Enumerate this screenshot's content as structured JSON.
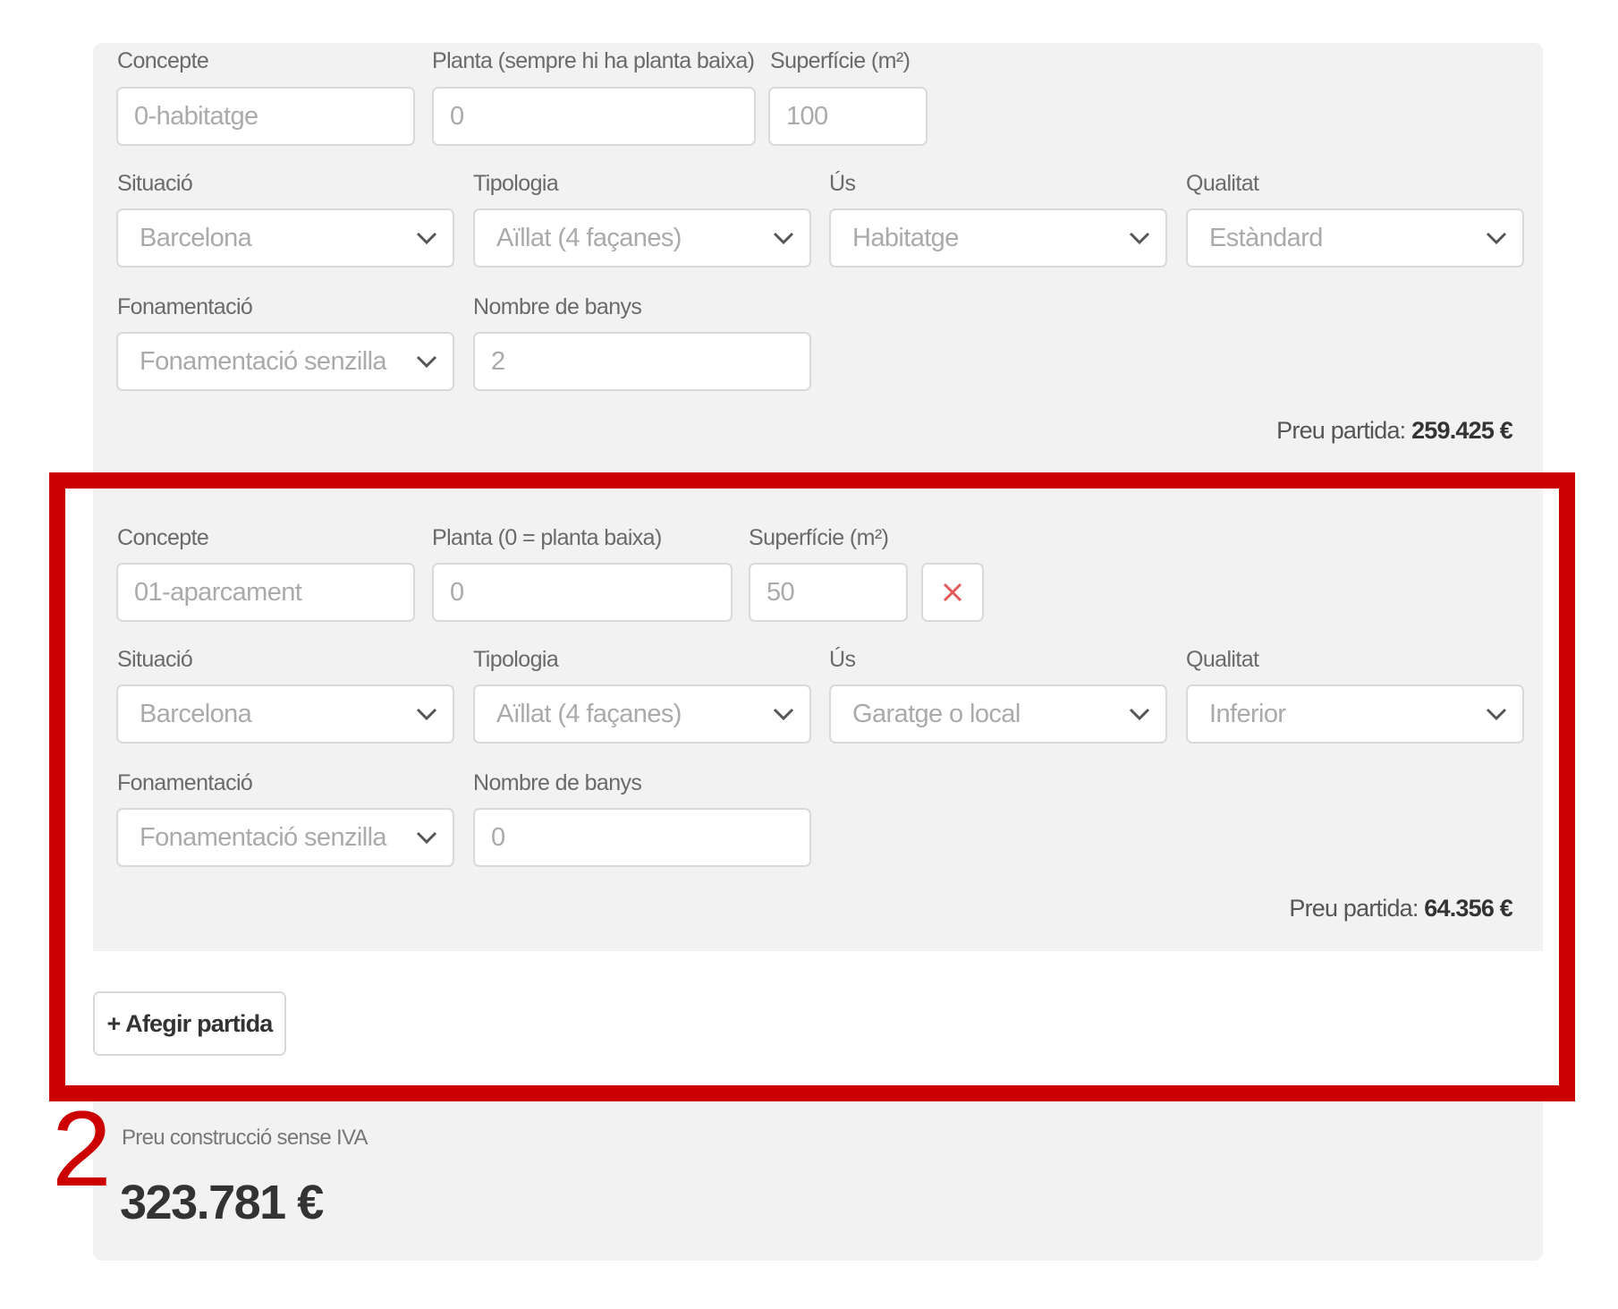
{
  "labels": {
    "concepte": "Concepte",
    "planta_first": "Planta (sempre hi ha planta baixa)",
    "planta_second": "Planta (0 = planta baixa)",
    "superficie": "Superfície (m²)",
    "situacio": "Situació",
    "tipologia": "Tipologia",
    "us": "Ús",
    "qualitat": "Qualitat",
    "fonamentacio": "Fonamentació",
    "banys": "Nombre de banys",
    "preu_partida": "Preu partida:"
  },
  "items": [
    {
      "concepte": "0-habitatge",
      "planta": "0",
      "superficie": "100",
      "situacio": "Barcelona",
      "tipologia": "Aïllat (4 façanes)",
      "us": "Habitatge",
      "qualitat": "Estàndard",
      "fonamentacio": "Fonamentació senzilla",
      "banys": "2",
      "preu": "259.425 €"
    },
    {
      "concepte": "01-aparcament",
      "planta": "0",
      "superficie": "50",
      "situacio": "Barcelona",
      "tipologia": "Aïllat (4 façanes)",
      "us": "Garatge o local",
      "qualitat": "Inferior",
      "fonamentacio": "Fonamentació senzilla",
      "banys": "0",
      "preu": "64.356 €"
    }
  ],
  "add_button": "+ Afegir partida",
  "annotation_number": "2",
  "total": {
    "label": "Preu construcció sense IVA",
    "value": "323.781 €"
  },
  "colors": {
    "highlight": "#cc0000",
    "panel": "#f2f2f2",
    "delete_icon": "#e05a5a"
  },
  "icons": {
    "select": "chevron-down-icon",
    "delete": "close-icon"
  }
}
